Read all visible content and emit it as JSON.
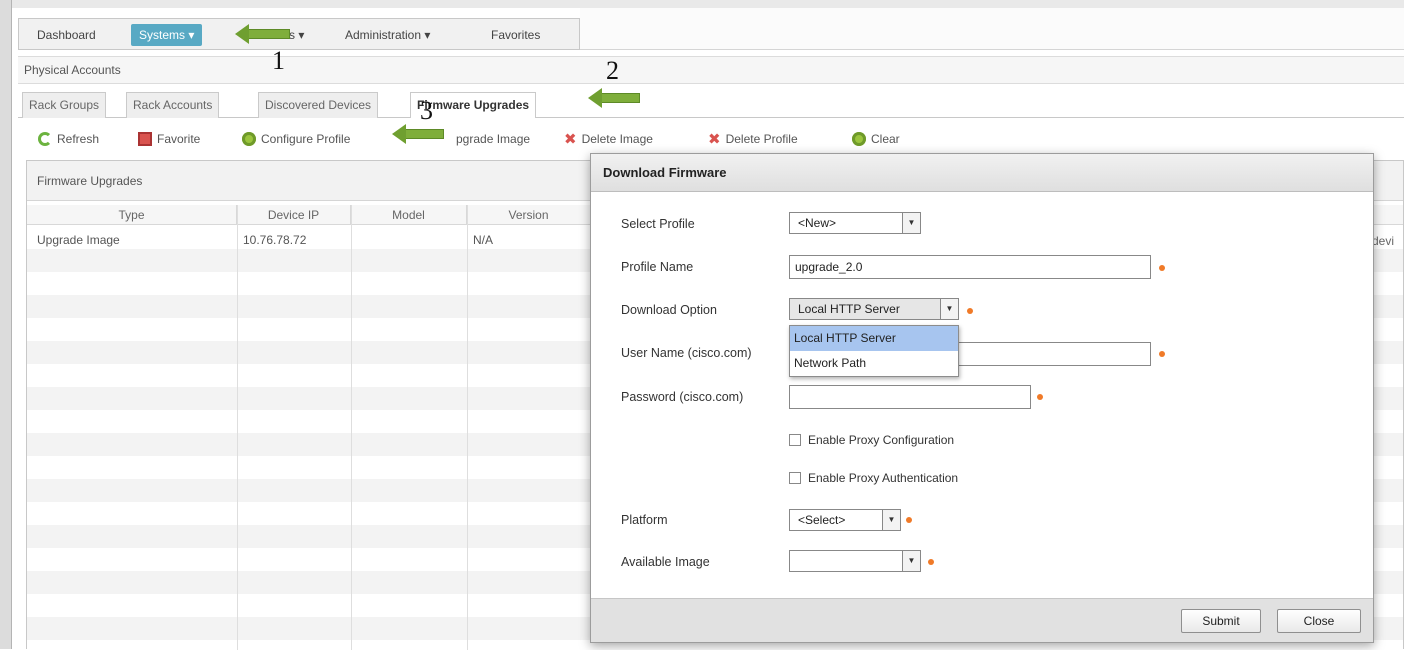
{
  "nav": {
    "dashboard": "Dashboard",
    "systems": "Systems ▾",
    "hidden_menu": "s ▾",
    "administration": "Administration ▾",
    "favorites": "Favorites"
  },
  "subheader": {
    "title": "Physical Accounts"
  },
  "tabs": [
    "Rack Groups",
    "Rack Accounts",
    "Discovered Devices",
    "Firmware Upgrades"
  ],
  "toolbar": {
    "refresh": "Refresh",
    "favorite": "Favorite",
    "configure_profile": "Configure Profile",
    "upgrade_image": "pgrade Image",
    "delete_image": "Delete Image",
    "delete_profile": "Delete Profile",
    "clear": "Clear"
  },
  "grid": {
    "title": "Firmware Upgrades",
    "columns": [
      "Type",
      "Device IP",
      "Model",
      "Version"
    ],
    "rows": [
      {
        "type": "Upgrade Image",
        "device_ip": "10.76.78.72",
        "model": "",
        "version": "N/A"
      }
    ],
    "cut_text": "devi"
  },
  "annotations": {
    "n1": "1",
    "n2": "2",
    "n3": "3"
  },
  "dialog": {
    "title": "Download Firmware",
    "select_profile_label": "Select Profile",
    "select_profile_value": "<New>",
    "profile_name_label": "Profile Name",
    "profile_name_value": "upgrade_2.0",
    "download_option_label": "Download Option",
    "download_option_value": "Local HTTP Server",
    "download_options": [
      "Local HTTP Server",
      "Network Path"
    ],
    "username_label": "User Name (cisco.com)",
    "username_value": "",
    "password_label": "Password (cisco.com)",
    "password_value": "",
    "proxy_config_label": "Enable Proxy Configuration",
    "proxy_auth_label": "Enable Proxy Authentication",
    "platform_label": "Platform",
    "platform_value": "<Select>",
    "available_image_label": "Available Image",
    "available_image_value": "",
    "submit": "Submit",
    "close": "Close"
  },
  "colors": {
    "accent": "#58a9c4",
    "arrow_green": "#7fae3b",
    "required_dot": "#f07a28",
    "highlight": "#a7c5ef"
  }
}
